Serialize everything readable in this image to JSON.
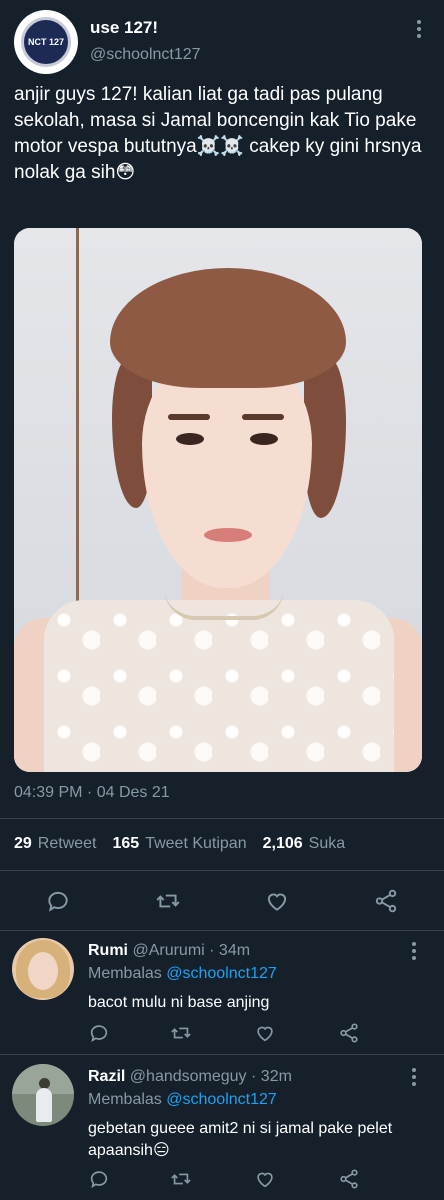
{
  "tweet": {
    "display_name": "use 127!",
    "handle": "@schoolnct127",
    "avatar_text": "NCT 127",
    "text": "anjir guys 127! kalian liat ga tadi pas pulang sekolah, masa si Jamal boncengin kak Tio pake motor vespa bututnya☠️☠️ cakep ky gini hrsnya nolak ga sih😳",
    "timestamp": "04:39 PM · 04 Des 21",
    "stats": {
      "retweets": "29",
      "retweets_label": "Retweet",
      "quotes": "165",
      "quotes_label": "Tweet Kutipan",
      "likes": "2,106",
      "likes_label": "Suka"
    }
  },
  "icons": {
    "reply": "reply-icon",
    "retweet": "retweet-icon",
    "like": "heart-icon",
    "share": "share-icon",
    "more": "more-vertical-icon"
  },
  "replies": [
    {
      "name": "Rumi",
      "handle": "@Arurumi",
      "time": "· 34m",
      "replying_label": "Membalas",
      "replying_to": "@schoolnct127",
      "text": "bacot mulu ni base anjing"
    },
    {
      "name": "Razil",
      "handle": "@handsomeguy",
      "time": "· 32m",
      "replying_label": "Membalas",
      "replying_to": "@schoolnct127",
      "text": "gebetan gueee amit2 ni si jamal pake pelet apaansih😑"
    }
  ],
  "colors": {
    "background": "#15202b",
    "muted": "#8899a6",
    "link": "#1da1f2",
    "divider": "#38444d"
  }
}
